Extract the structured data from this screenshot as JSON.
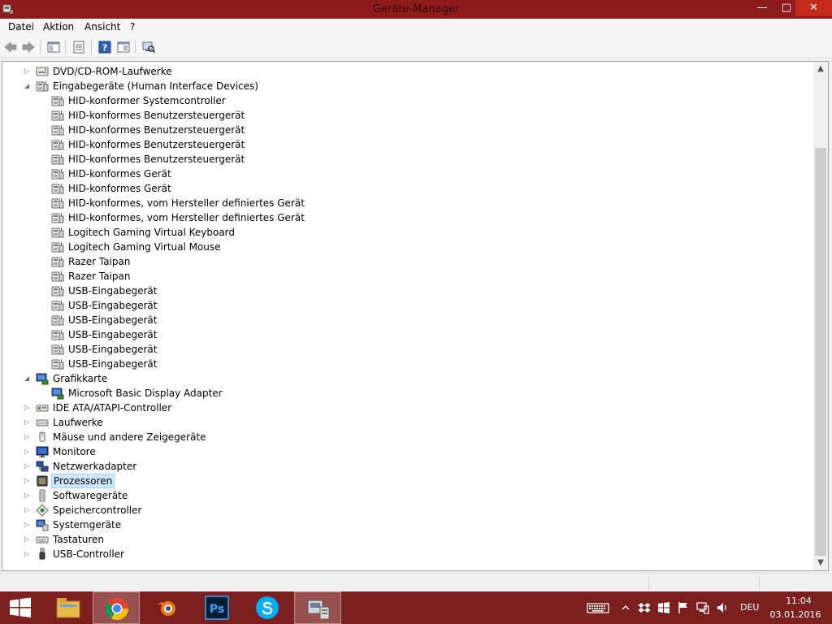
{
  "window": {
    "title": "Geräte-Manager",
    "controls": {
      "minimize": "—",
      "maximize": "□",
      "close": "✕"
    }
  },
  "menu": [
    "Datei",
    "Aktion",
    "Ansicht",
    "?"
  ],
  "toolbar": [
    "back-icon",
    "forward-icon",
    "show-hide-console-tree-icon",
    "properties-icon",
    "help-icon",
    "view-icon",
    "scan-hardware-icon"
  ],
  "tree": [
    {
      "label": "DVD/CD-ROM-Laufwerke",
      "level": 0,
      "state": "collapsed",
      "icon": "dvd-drive-icon"
    },
    {
      "label": "Eingabegeräte (Human Interface Devices)",
      "level": 0,
      "state": "expanded",
      "icon": "hid-icon"
    },
    {
      "label": "HID-konformer Systemcontroller",
      "level": 1,
      "icon": "hid-icon"
    },
    {
      "label": "HID-konformes Benutzersteuergerät",
      "level": 1,
      "icon": "hid-icon"
    },
    {
      "label": "HID-konformes Benutzersteuergerät",
      "level": 1,
      "icon": "hid-icon"
    },
    {
      "label": "HID-konformes Benutzersteuergerät",
      "level": 1,
      "icon": "hid-icon"
    },
    {
      "label": "HID-konformes Benutzersteuergerät",
      "level": 1,
      "icon": "hid-icon"
    },
    {
      "label": "HID-konformes Gerät",
      "level": 1,
      "icon": "hid-icon"
    },
    {
      "label": "HID-konformes Gerät",
      "level": 1,
      "icon": "hid-icon"
    },
    {
      "label": "HID-konformes, vom Hersteller definiertes Gerät",
      "level": 1,
      "icon": "hid-icon"
    },
    {
      "label": "HID-konformes, vom Hersteller definiertes Gerät",
      "level": 1,
      "icon": "hid-icon"
    },
    {
      "label": "Logitech Gaming Virtual Keyboard",
      "level": 1,
      "icon": "hid-icon"
    },
    {
      "label": "Logitech Gaming Virtual Mouse",
      "level": 1,
      "icon": "hid-icon"
    },
    {
      "label": "Razer Taipan",
      "level": 1,
      "icon": "hid-icon"
    },
    {
      "label": "Razer Taipan",
      "level": 1,
      "icon": "hid-icon"
    },
    {
      "label": "USB-Eingabegerät",
      "level": 1,
      "icon": "hid-icon"
    },
    {
      "label": "USB-Eingabegerät",
      "level": 1,
      "icon": "hid-icon"
    },
    {
      "label": "USB-Eingabegerät",
      "level": 1,
      "icon": "hid-icon"
    },
    {
      "label": "USB-Eingabegerät",
      "level": 1,
      "icon": "hid-icon"
    },
    {
      "label": "USB-Eingabegerät",
      "level": 1,
      "icon": "hid-icon"
    },
    {
      "label": "USB-Eingabegerät",
      "level": 1,
      "icon": "hid-icon"
    },
    {
      "label": "Grafikkarte",
      "level": 0,
      "state": "expanded",
      "icon": "display-adapter-icon"
    },
    {
      "label": "Microsoft Basic Display Adapter",
      "level": 1,
      "icon": "display-adapter-icon"
    },
    {
      "label": "IDE ATA/ATAPI-Controller",
      "level": 0,
      "state": "collapsed",
      "icon": "ide-controller-icon"
    },
    {
      "label": "Laufwerke",
      "level": 0,
      "state": "collapsed",
      "icon": "disk-drive-icon"
    },
    {
      "label": "Mäuse und andere Zeigegeräte",
      "level": 0,
      "state": "collapsed",
      "icon": "mouse-icon"
    },
    {
      "label": "Monitore",
      "level": 0,
      "state": "collapsed",
      "icon": "monitor-icon"
    },
    {
      "label": "Netzwerkadapter",
      "level": 0,
      "state": "collapsed",
      "icon": "network-adapter-icon"
    },
    {
      "label": "Prozessoren",
      "level": 0,
      "state": "collapsed",
      "icon": "processor-icon",
      "selected": true
    },
    {
      "label": "Softwaregeräte",
      "level": 0,
      "state": "collapsed",
      "icon": "software-device-icon"
    },
    {
      "label": "Speichercontroller",
      "level": 0,
      "state": "collapsed",
      "icon": "storage-controller-icon"
    },
    {
      "label": "Systemgeräte",
      "level": 0,
      "state": "collapsed",
      "icon": "system-device-icon"
    },
    {
      "label": "Tastaturen",
      "level": 0,
      "state": "collapsed",
      "icon": "keyboard-icon"
    },
    {
      "label": "USB-Controller",
      "level": 0,
      "state": "collapsed",
      "icon": "usb-icon"
    }
  ],
  "taskbar": {
    "apps": [
      {
        "name": "file-explorer-icon",
        "active": false
      },
      {
        "name": "chrome-icon",
        "active": true
      },
      {
        "name": "blender-icon",
        "active": false
      },
      {
        "name": "photoshop-icon",
        "active": false,
        "text": "Ps"
      },
      {
        "name": "skype-icon",
        "active": false
      },
      {
        "name": "device-manager-icon",
        "active": true
      }
    ],
    "tray": [
      "keyboard-tray-icon",
      "show-hidden-icons-icon",
      "dropbox-icon",
      "windows-icon",
      "flag-icon",
      "network-icon",
      "volume-icon"
    ],
    "language": "DEU",
    "time": "11:04",
    "date": "03.01.2016"
  },
  "colors": {
    "titlebar": "#8e1c1c",
    "taskbar": "#7b1f1f",
    "close_button": "#c42b1c",
    "selection": "#cce8ff"
  }
}
